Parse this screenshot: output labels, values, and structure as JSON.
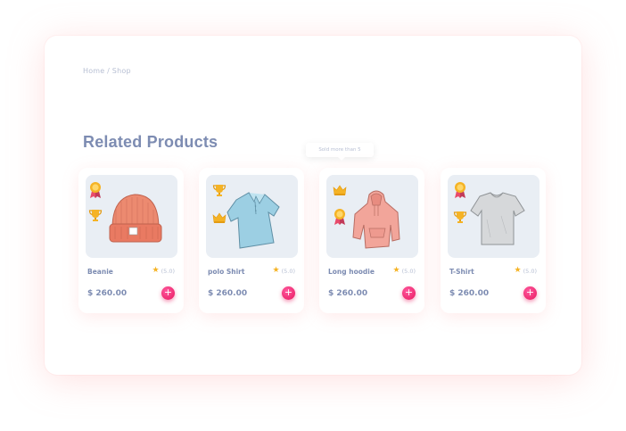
{
  "breadcrumb": "Home / Shop",
  "section_title": "Related Products",
  "tooltip": "Sold more than 5",
  "colors": {
    "accent": "#e8175d",
    "text": "#7d8cb2",
    "muted": "#b7bfd3",
    "star": "#f5b325"
  },
  "products": [
    {
      "name": "Beanie",
      "rating": "(5.0)",
      "price": "$ 260.00",
      "add_label": "+",
      "badges": [
        "award-ribbon-icon",
        "trophy-icon"
      ],
      "image": "beanie-image"
    },
    {
      "name": "polo Shirt",
      "rating": "(5.0)",
      "price": "$ 260.00",
      "add_label": "+",
      "badges": [
        "trophy-icon",
        "crown-icon"
      ],
      "image": "polo-shirt-image"
    },
    {
      "name": "Long hoodie",
      "rating": "(5.0)",
      "price": "$ 260.00",
      "add_label": "+",
      "badges": [
        "crown-icon",
        "award-ribbon-icon"
      ],
      "image": "hoodie-image"
    },
    {
      "name": "T-Shirt",
      "rating": "(5.0)",
      "price": "$ 260.00",
      "add_label": "+",
      "badges": [
        "award-ribbon-icon",
        "trophy-icon"
      ],
      "image": "tshirt-image"
    }
  ]
}
